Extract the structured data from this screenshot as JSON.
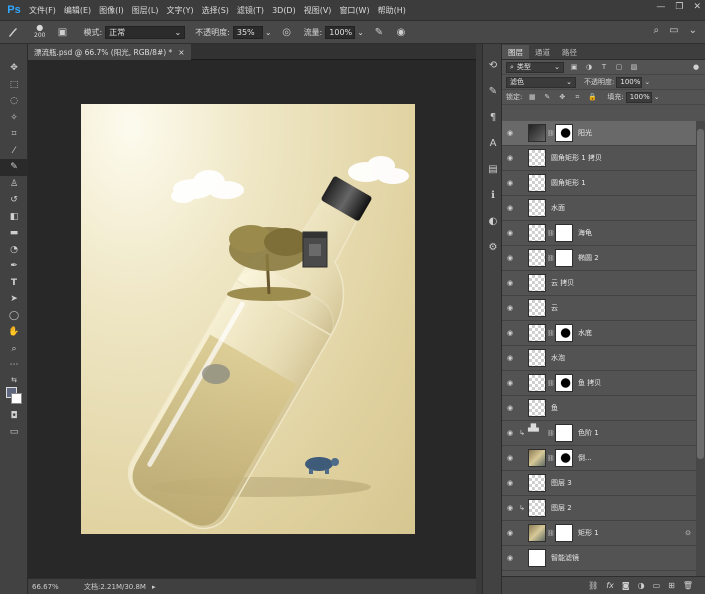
{
  "app": {
    "logo": "Ps"
  },
  "menu": [
    "文件(F)",
    "编辑(E)",
    "图像(I)",
    "图层(L)",
    "文字(Y)",
    "选择(S)",
    "滤镜(T)",
    "3D(D)",
    "视图(V)",
    "窗口(W)",
    "帮助(H)"
  ],
  "window_buttons": {
    "minimize": "—",
    "restore": "❐",
    "close": "✕"
  },
  "options": {
    "brush_size": "200",
    "mode_label": "模式:",
    "mode_value": "正常",
    "opacity_label": "不透明度:",
    "opacity_value": "35%",
    "flow_label": "流量:",
    "flow_value": "100%"
  },
  "document": {
    "tab_title": "漂流瓶.psd @ 66.7% (阳光, RGB/8#) *",
    "close_glyph": "×"
  },
  "status": {
    "zoom": "66.67%",
    "doc_info": "文档:2.21M/30.8M",
    "arrow": "▸"
  },
  "panel": {
    "tabs": [
      "图层",
      "通道",
      "路径"
    ],
    "filter_kind": "类型",
    "blend_mode": "滤色",
    "opacity_label": "不透明度:",
    "opacity_value": "100%",
    "lock_label": "锁定:",
    "fill_label": "填充:",
    "fill_value": "100%"
  },
  "layers": [
    {
      "name": "阳光",
      "thumb": "dark",
      "mask": "blk",
      "selected": true
    },
    {
      "name": "圆角矩形 1 拷贝",
      "thumb": "trans"
    },
    {
      "name": "圆角矩形 1",
      "thumb": "trans"
    },
    {
      "name": "水面",
      "thumb": "trans"
    },
    {
      "name": "海龟",
      "thumb": "trans",
      "mask": "wht"
    },
    {
      "name": "椭圆 2",
      "thumb": "trans",
      "mask": "wht"
    },
    {
      "name": "云 拷贝",
      "thumb": "trans"
    },
    {
      "name": "云",
      "thumb": "trans"
    },
    {
      "name": "水底",
      "thumb": "trans",
      "mask": "blk"
    },
    {
      "name": "水泡",
      "thumb": "trans"
    },
    {
      "name": "鱼 拷贝",
      "thumb": "trans",
      "mask": "blk"
    },
    {
      "name": "鱼",
      "thumb": "trans"
    },
    {
      "name": "色阶 1",
      "thumb": "adj",
      "mask": "wht",
      "clip": true
    },
    {
      "name": "倒...",
      "thumb": "img",
      "mask": "blk"
    },
    {
      "name": "图层 3",
      "thumb": "trans"
    },
    {
      "name": "图层 2",
      "thumb": "trans",
      "clip": true
    },
    {
      "name": "矩形 1",
      "thumb": "img",
      "mask": "wht",
      "fx": true
    },
    {
      "name": "智能滤镜",
      "thumb": "wht"
    }
  ]
}
